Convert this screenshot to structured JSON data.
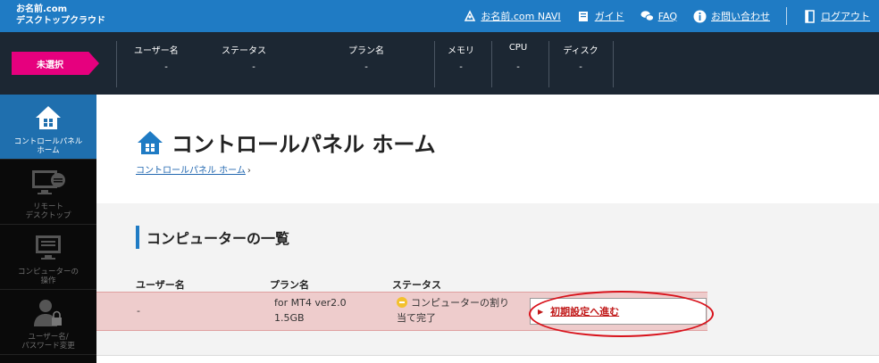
{
  "header": {
    "logo_line1": "お名前.com",
    "logo_line2": "デスクトップクラウド",
    "nav": {
      "navi": "お名前.com NAVI",
      "guide": "ガイド",
      "faq": "FAQ",
      "contact": "お問い合わせ",
      "logout": "ログアウト"
    }
  },
  "statusbar": {
    "unselected": "未選択",
    "columns": [
      {
        "label": "ユーザー名",
        "value": "-"
      },
      {
        "label": "ステータス",
        "value": "-"
      },
      {
        "label": "プラン名",
        "value": "-"
      },
      {
        "label": "メモリ",
        "value": "-"
      },
      {
        "label": "CPU",
        "value": "-"
      },
      {
        "label": "ディスク",
        "value": "-"
      }
    ]
  },
  "sidebar": {
    "items": [
      {
        "line1": "コントロールパネル",
        "line2": "ホーム"
      },
      {
        "line1": "リモート",
        "line2": "デスクトップ"
      },
      {
        "line1": "コンピューターの",
        "line2": "操作"
      },
      {
        "line1": "ユーザー名/",
        "line2": "パスワード変更"
      }
    ]
  },
  "main": {
    "title": "コントロールパネル ホーム",
    "breadcrumb": {
      "link": "コントロールパネル ホーム",
      "arrow": "›"
    },
    "section_title": "コンピューターの一覧",
    "table": {
      "headers": {
        "user": "ユーザー名",
        "plan": "プラン名",
        "status": "ステータス"
      },
      "row": {
        "user": "-",
        "plan_line1": "for MT4 ver2.0",
        "plan_line2": "1.5GB",
        "status_line1": "コンピューターの割り",
        "status_line2": "当て完了"
      },
      "action": "初期設定へ進む"
    }
  },
  "colors": {
    "topbar": "#1f7bc4",
    "statusbar": "#1c2733",
    "accent_pink": "#e6007e",
    "row_highlight": "#eecccc",
    "annotation_red": "#d8121b"
  }
}
